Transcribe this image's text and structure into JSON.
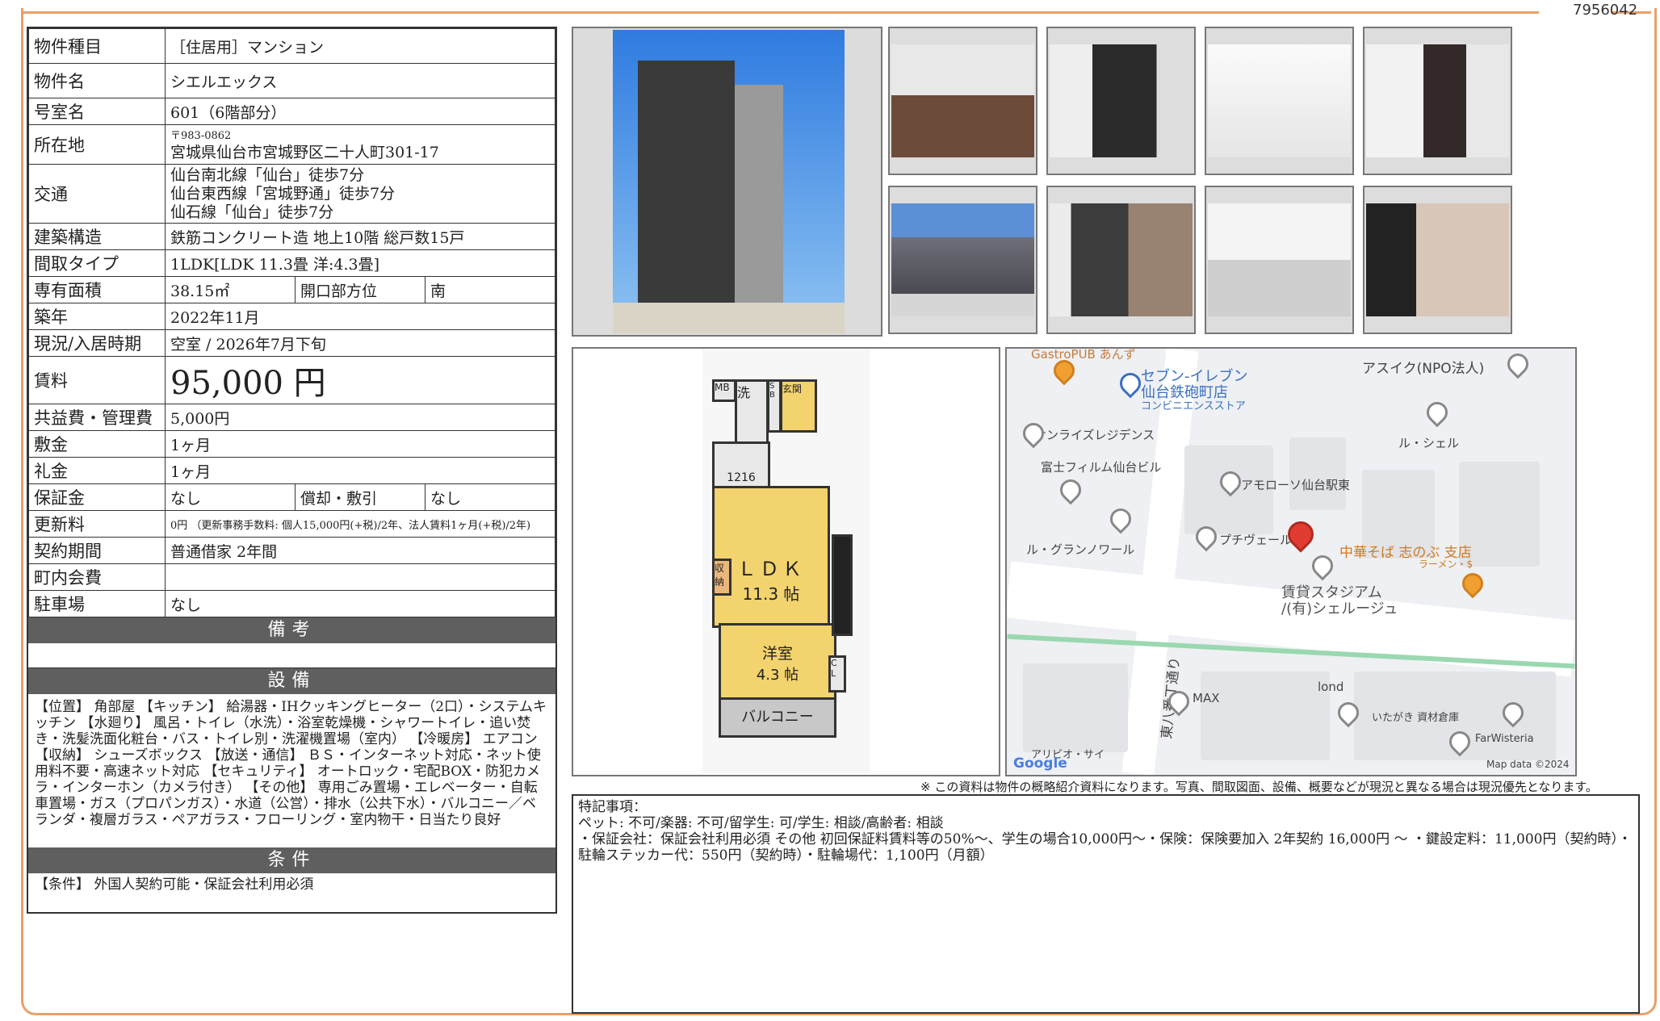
{
  "doc_code": "7956042",
  "property": {
    "type_label": "物件種目",
    "type_value": "［住居用］マンション",
    "name_label": "物件名",
    "name_value": "シエルエックス",
    "room_label": "号室名",
    "room_value": "601（6階部分）",
    "address_label": "所在地",
    "postal": "〒983-0862",
    "address": "宮城県仙台市宮城野区二十人町301-17",
    "transport_label": "交通",
    "transport": [
      "仙台南北線「仙台」徒歩7分",
      "仙台東西線「宮城野通」徒歩7分",
      "仙石線「仙台」徒歩7分"
    ],
    "structure_label": "建築構造",
    "structure_value": "鉄筋コンクリート造 地上10階 総戸数15戸",
    "layout_label": "間取タイプ",
    "layout_value": "1LDK[LDK 11.3畳 洋:4.3畳]",
    "area_label": "専有面積",
    "area_value": "38.15㎡",
    "orient_label": "開口部方位",
    "orient_value": "南",
    "built_label": "築年",
    "built_value": "2022年11月",
    "status_label": "現況/入居時期",
    "status_value": "空室 / 2026年7月下旬",
    "rent_label": "賃料",
    "rent_value": "95,000 円",
    "fee_label": "共益費・管理費",
    "fee_value": "5,000円",
    "deposit_label": "敷金",
    "deposit_value": "1ヶ月",
    "key_label": "礼金",
    "key_value": "1ヶ月",
    "guar_label": "保証金",
    "guar_value": "なし",
    "amort_label": "償却・敷引",
    "amort_value": "なし",
    "renew_label": "更新料",
    "renew_value": "0円 （更新事務手数料: 個人15,000円(+税)/2年、法人賃料1ヶ月(+税)/2年)",
    "contract_label": "契約期間",
    "contract_value": "普通借家 2年間",
    "town_label": "町内会費",
    "town_value": "",
    "parking_label": "駐車場",
    "parking_value": "なし"
  },
  "sections": {
    "remarks_head": "備考",
    "equip_head": "設備",
    "equip_text": "【位置】 角部屋 【キッチン】 給湯器・IHクッキングヒーター（2口）・システムキッチン 【水廻り】 風呂・トイレ（水洗）・浴室乾燥機・シャワートイレ・追い焚き・洗髪洗面化粧台・バス・トイレ別・洗濯機置場（室内） 【冷暖房】 エアコン 【収納】 シューズボックス 【放送・通信】 ＢＳ・インターネット対応・ネット使用料不要・高速ネット対応 【セキュリティ】 オートロック・宅配BOX・防犯カメラ・インターホン（カメラ付き） 【その他】 専用ごみ置場・エレベーター・自転車置場・ガス（プロパンガス）・水道（公営）・排水（公共下水）・バルコニー／ベランダ・複層ガラス・ペアガラス・フローリング・室内物干・日当たり良好",
    "cond_head": "条件",
    "cond_text": "【条件】 外国人契約可能・保証会社利用必須"
  },
  "floorplan": {
    "mb": "MB",
    "wash": "洗",
    "shoes": "S B",
    "entry": "玄関",
    "bath": "1216",
    "ldk": "ＬＤＫ",
    "ldk_size": "11.3 帖",
    "storage": "収納",
    "western": "洋室",
    "western_size": "4.3 帖",
    "cl": "C L",
    "balcony": "バルコニー"
  },
  "map": {
    "labels": [
      "GastroPUB あんず",
      "セブン-イレブン",
      "仙台鉄砲町店",
      "コンビニエンスストア",
      "アスイク(NPO法人)",
      "サンライズレジデンス",
      "ル・シェル",
      "富士フィルム仙台ビル",
      "アモローソ仙台駅東",
      "ル・グランノワール",
      "プチヴェール",
      "中華そば 志のぶ 支店",
      "ラーメン・$",
      "賃貸スタジアム",
      "/(有)シェルージュ",
      "東八番丁通り",
      "MAX",
      "lond",
      "いたがき 資材倉庫",
      "FarWisteria",
      "アリビオ・サイ",
      "Map data ©2024",
      "Google"
    ]
  },
  "footnote": "※ この資料は物件の概略紹介資料になります。写真、間取図面、設備、概要などが現況と異なる場合は現況優先となります。",
  "special": {
    "title": "特記事項：",
    "line1": "ペット: 不可/楽器: 不可/留学生: 可/学生: 相談/高齢者: 相談",
    "line2": "・保証会社：保証会社利用必須 その他 初回保証料賃料等の50%～、学生の場合10,000円～・保険：保険要加入 2年契約 16,000円 ～ ・鍵設定料：11,000円（契約時）・駐輪ステッカー代：550円（契約時）・駐輪場代：1,100円（月額）"
  }
}
